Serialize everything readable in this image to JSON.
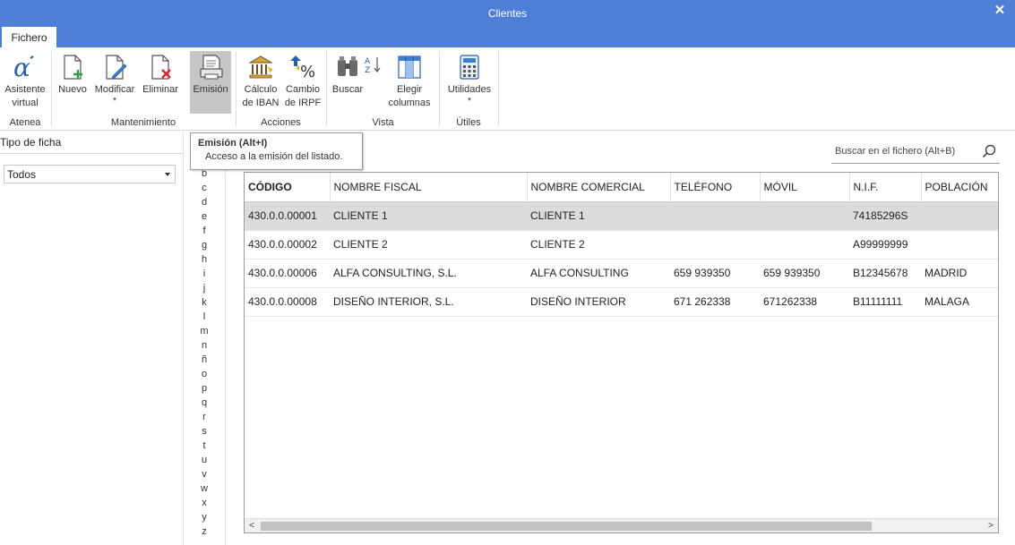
{
  "window": {
    "title": "Clientes"
  },
  "menu": {
    "tab_label": "Fichero"
  },
  "ribbon": {
    "groups": [
      {
        "label": "Atenea",
        "buttons": [
          {
            "label1": "Asistente",
            "label2": "virtual",
            "icon": "alpha-icon"
          }
        ]
      },
      {
        "label": "Mantenimiento",
        "buttons": [
          {
            "label1": "Nuevo",
            "label2": "",
            "icon": "new-doc-icon"
          },
          {
            "label1": "Modificar",
            "label2": "▾",
            "icon": "edit-doc-icon"
          },
          {
            "label1": "Eliminar",
            "label2": "",
            "icon": "delete-doc-icon"
          },
          {
            "label1": "Emisión",
            "label2": "",
            "icon": "print-doc-icon"
          }
        ]
      },
      {
        "label": "Acciones",
        "buttons": [
          {
            "label1": "Cálculo",
            "label2": "de IBAN",
            "icon": "bank-icon"
          },
          {
            "label1": "Cambio",
            "label2": "de IRPF",
            "icon": "percent-icon"
          }
        ]
      },
      {
        "label": "Vista",
        "buttons": [
          {
            "label1": "Buscar",
            "label2": "",
            "icon": "binoculars-icon"
          },
          {
            "label1": "Elegir",
            "label2": "columnas",
            "icon": "columns-icon"
          }
        ]
      },
      {
        "label": "Útiles",
        "buttons": [
          {
            "label1": "Utilidades",
            "label2": "▾",
            "icon": "calculator-icon"
          }
        ]
      }
    ]
  },
  "tooltip": {
    "title": "Emisión (Alt+I)",
    "description": "Acceso a la emisión del listado."
  },
  "left_pane": {
    "title": "Tipo de ficha",
    "filter_value": "Todos"
  },
  "alphabet": [
    "b",
    "c",
    "d",
    "e",
    "f",
    "g",
    "h",
    "i",
    "j",
    "k",
    "l",
    "m",
    "n",
    "ñ",
    "o",
    "p",
    "q",
    "r",
    "s",
    "t",
    "u",
    "v",
    "w",
    "x",
    "y",
    "z"
  ],
  "search": {
    "placeholder": "Buscar en el fichero (Alt+B)"
  },
  "table": {
    "columns": [
      "CÓDIGO",
      "NOMBRE FISCAL",
      "NOMBRE COMERCIAL",
      "TELÉFONO",
      "MÓVIL",
      "N.I.F.",
      "POBLACIÓN"
    ],
    "rows": [
      [
        "430.0.0.00001",
        "CLIENTE 1",
        "CLIENTE 1",
        "",
        "",
        "74185296S",
        ""
      ],
      [
        "430.0.0.00002",
        "CLIENTE 2",
        "CLIENTE 2",
        "",
        "",
        "A99999999",
        ""
      ],
      [
        "430.0.0.00006",
        "ALFA CONSULTING, S.L.",
        "ALFA CONSULTING",
        "659 939350",
        "659 939350",
        "B12345678",
        "MADRID"
      ],
      [
        "430.0.0.00008",
        "DISEÑO INTERIOR, S.L.",
        "DISEÑO INTERIOR",
        "671 262338",
        "671262338",
        "B11111111",
        "MALAGA"
      ]
    ]
  },
  "colors": {
    "titlebar": "#4d7fd6",
    "selected_row": "#dcdcdc",
    "active_button": "#c6c6c6"
  }
}
